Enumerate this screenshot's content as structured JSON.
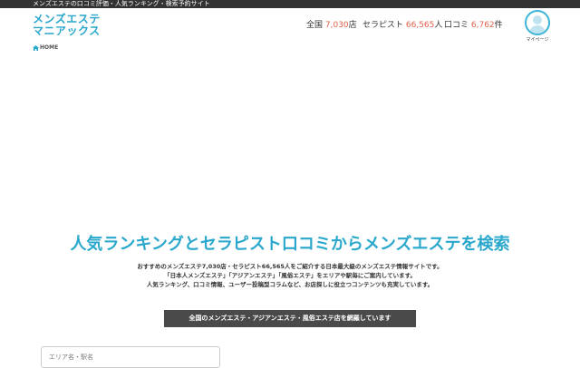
{
  "topbar": {
    "tagline": "メンズエステの口コミ評価・人気ランキング・検索予約サイト"
  },
  "header": {
    "logo_line1": "メンズエステ",
    "logo_line2": "マニアックス",
    "stats": [
      {
        "label": "全国",
        "value": "7,030",
        "unit": "店"
      },
      {
        "label": "セラピスト",
        "value": "66,565",
        "unit": "人"
      },
      {
        "label": "口コミ",
        "value": "6,762",
        "unit": "件"
      }
    ],
    "mypage_label": "マイページ"
  },
  "breadcrumb": {
    "home": "HOME"
  },
  "hero": {
    "title": "人気ランキングとセラピスト口コミからメンズエステを検索",
    "desc_lines": [
      "おすすめのメンズエステ7,030店・セラピスト66,565人をご紹介する日本最大級のメンズエステ情報サイトです。",
      "「日本人メンズエステ」「アジアンエステ」「風俗エステ」をエリアや駅毎にご案内しています。",
      "人気ランキング、口コミ情報、ユーザー投稿型コラムなど、お店探しに役立つコンテンツも充実しています。"
    ],
    "banner": "全国のメンズエステ・アジアンエステ・風俗エステ店を網羅しています"
  },
  "search": {
    "placeholder": "エリア名・駅名"
  },
  "colors": {
    "brand": "#2aa7cc",
    "accent": "#e0604a",
    "topbar": "#333333",
    "banner": "#4a4a4a"
  }
}
